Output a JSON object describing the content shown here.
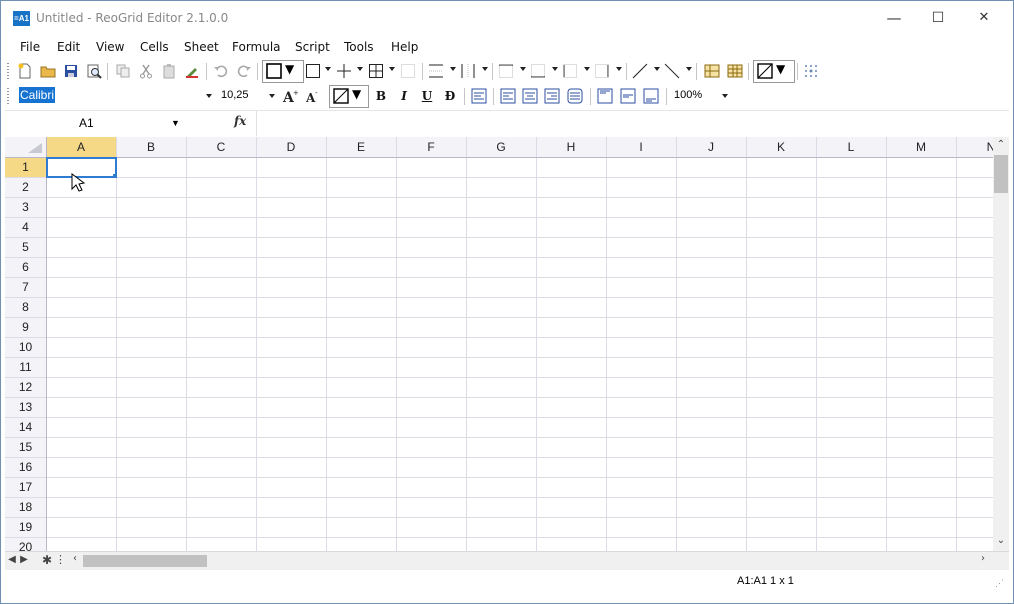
{
  "window": {
    "title": "Untitled - ReoGrid Editor 2.1.0.0",
    "app_icon_text": "=A1",
    "controls": {
      "minimize": "—",
      "maximize": "☐",
      "close": "✕"
    }
  },
  "menu": [
    "File",
    "Edit",
    "View",
    "Cells",
    "Sheet",
    "Formula",
    "Script",
    "Tools",
    "Help"
  ],
  "format_bar": {
    "font": "Calibri",
    "font_size": "10,25",
    "zoom": "100%",
    "bold": "B",
    "italic": "I",
    "underline": "U",
    "strikethrough": "Đ"
  },
  "formula_bar": {
    "name_box": "A1",
    "fx_label": "fx",
    "formula": ""
  },
  "grid": {
    "columns": [
      "A",
      "B",
      "C",
      "D",
      "E",
      "F",
      "G",
      "H",
      "I",
      "J",
      "K",
      "L",
      "M",
      "N"
    ],
    "rows": [
      "1",
      "2",
      "3",
      "4",
      "5",
      "6",
      "7",
      "8",
      "9",
      "10",
      "11",
      "12",
      "13",
      "14",
      "15",
      "16",
      "17",
      "18",
      "19",
      "20"
    ],
    "selected_cell": "A1"
  },
  "status": {
    "selection": "A1:A1 1 x 1"
  },
  "colors": {
    "header_bg": "#f4f4f8",
    "header_selected": "#f6d987",
    "selection_border": "#2f7bd1",
    "grid_line": "#dcdce6",
    "font_highlight": "#1673d2"
  }
}
